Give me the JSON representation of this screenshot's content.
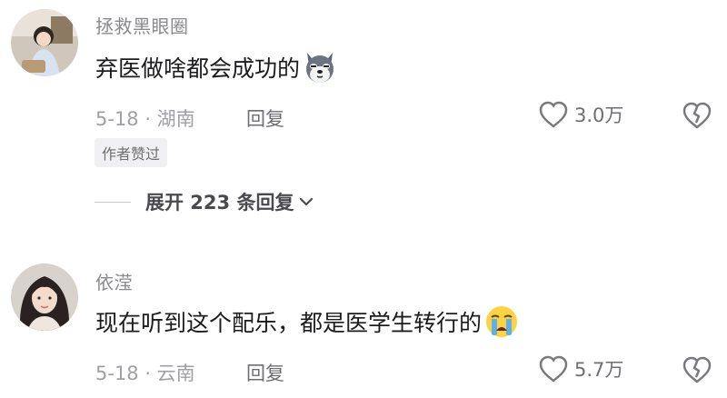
{
  "comments": [
    {
      "username": "拯救黑眼圈",
      "text": "弃医做啥都会成功的",
      "emoji": "dog-face-emoji",
      "date_location": "5-18 · 湖南",
      "reply_label": "回复",
      "likes": "3.0万",
      "badge": "作者赞过"
    },
    {
      "username": "依滢",
      "text": "现在听到这个配乐，都是医学生转行的",
      "emoji": "crying-face-emoji",
      "date_location": "5-18 · 云南",
      "reply_label": "回复",
      "likes": "5.7万"
    }
  ],
  "expand_replies": "展开 223 条回复"
}
